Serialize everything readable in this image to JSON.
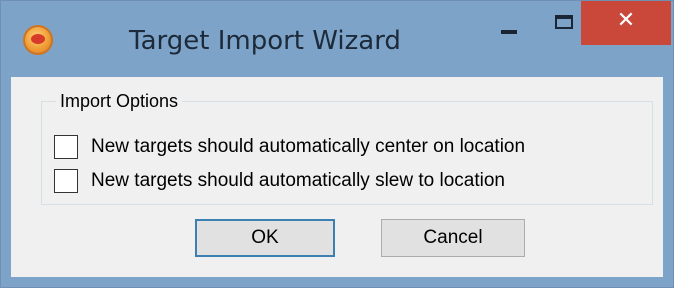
{
  "window": {
    "title": "Target Import Wizard",
    "app_icon": "app-logo-icon",
    "controls": {
      "minimize_icon": "minimize-icon",
      "maximize_icon": "maximize-icon",
      "close_glyph": "✕",
      "close_color": "#c9483a"
    }
  },
  "group": {
    "label": "Import Options",
    "options": [
      {
        "label": "New targets should automatically center on location",
        "checked": false
      },
      {
        "label": "New targets should automatically slew to location",
        "checked": false
      }
    ]
  },
  "buttons": {
    "ok_label": "OK",
    "cancel_label": "Cancel"
  },
  "colors": {
    "frame": "#7ea3c9",
    "client": "#f0f0f0",
    "default_button_border": "#3c7fb1"
  }
}
